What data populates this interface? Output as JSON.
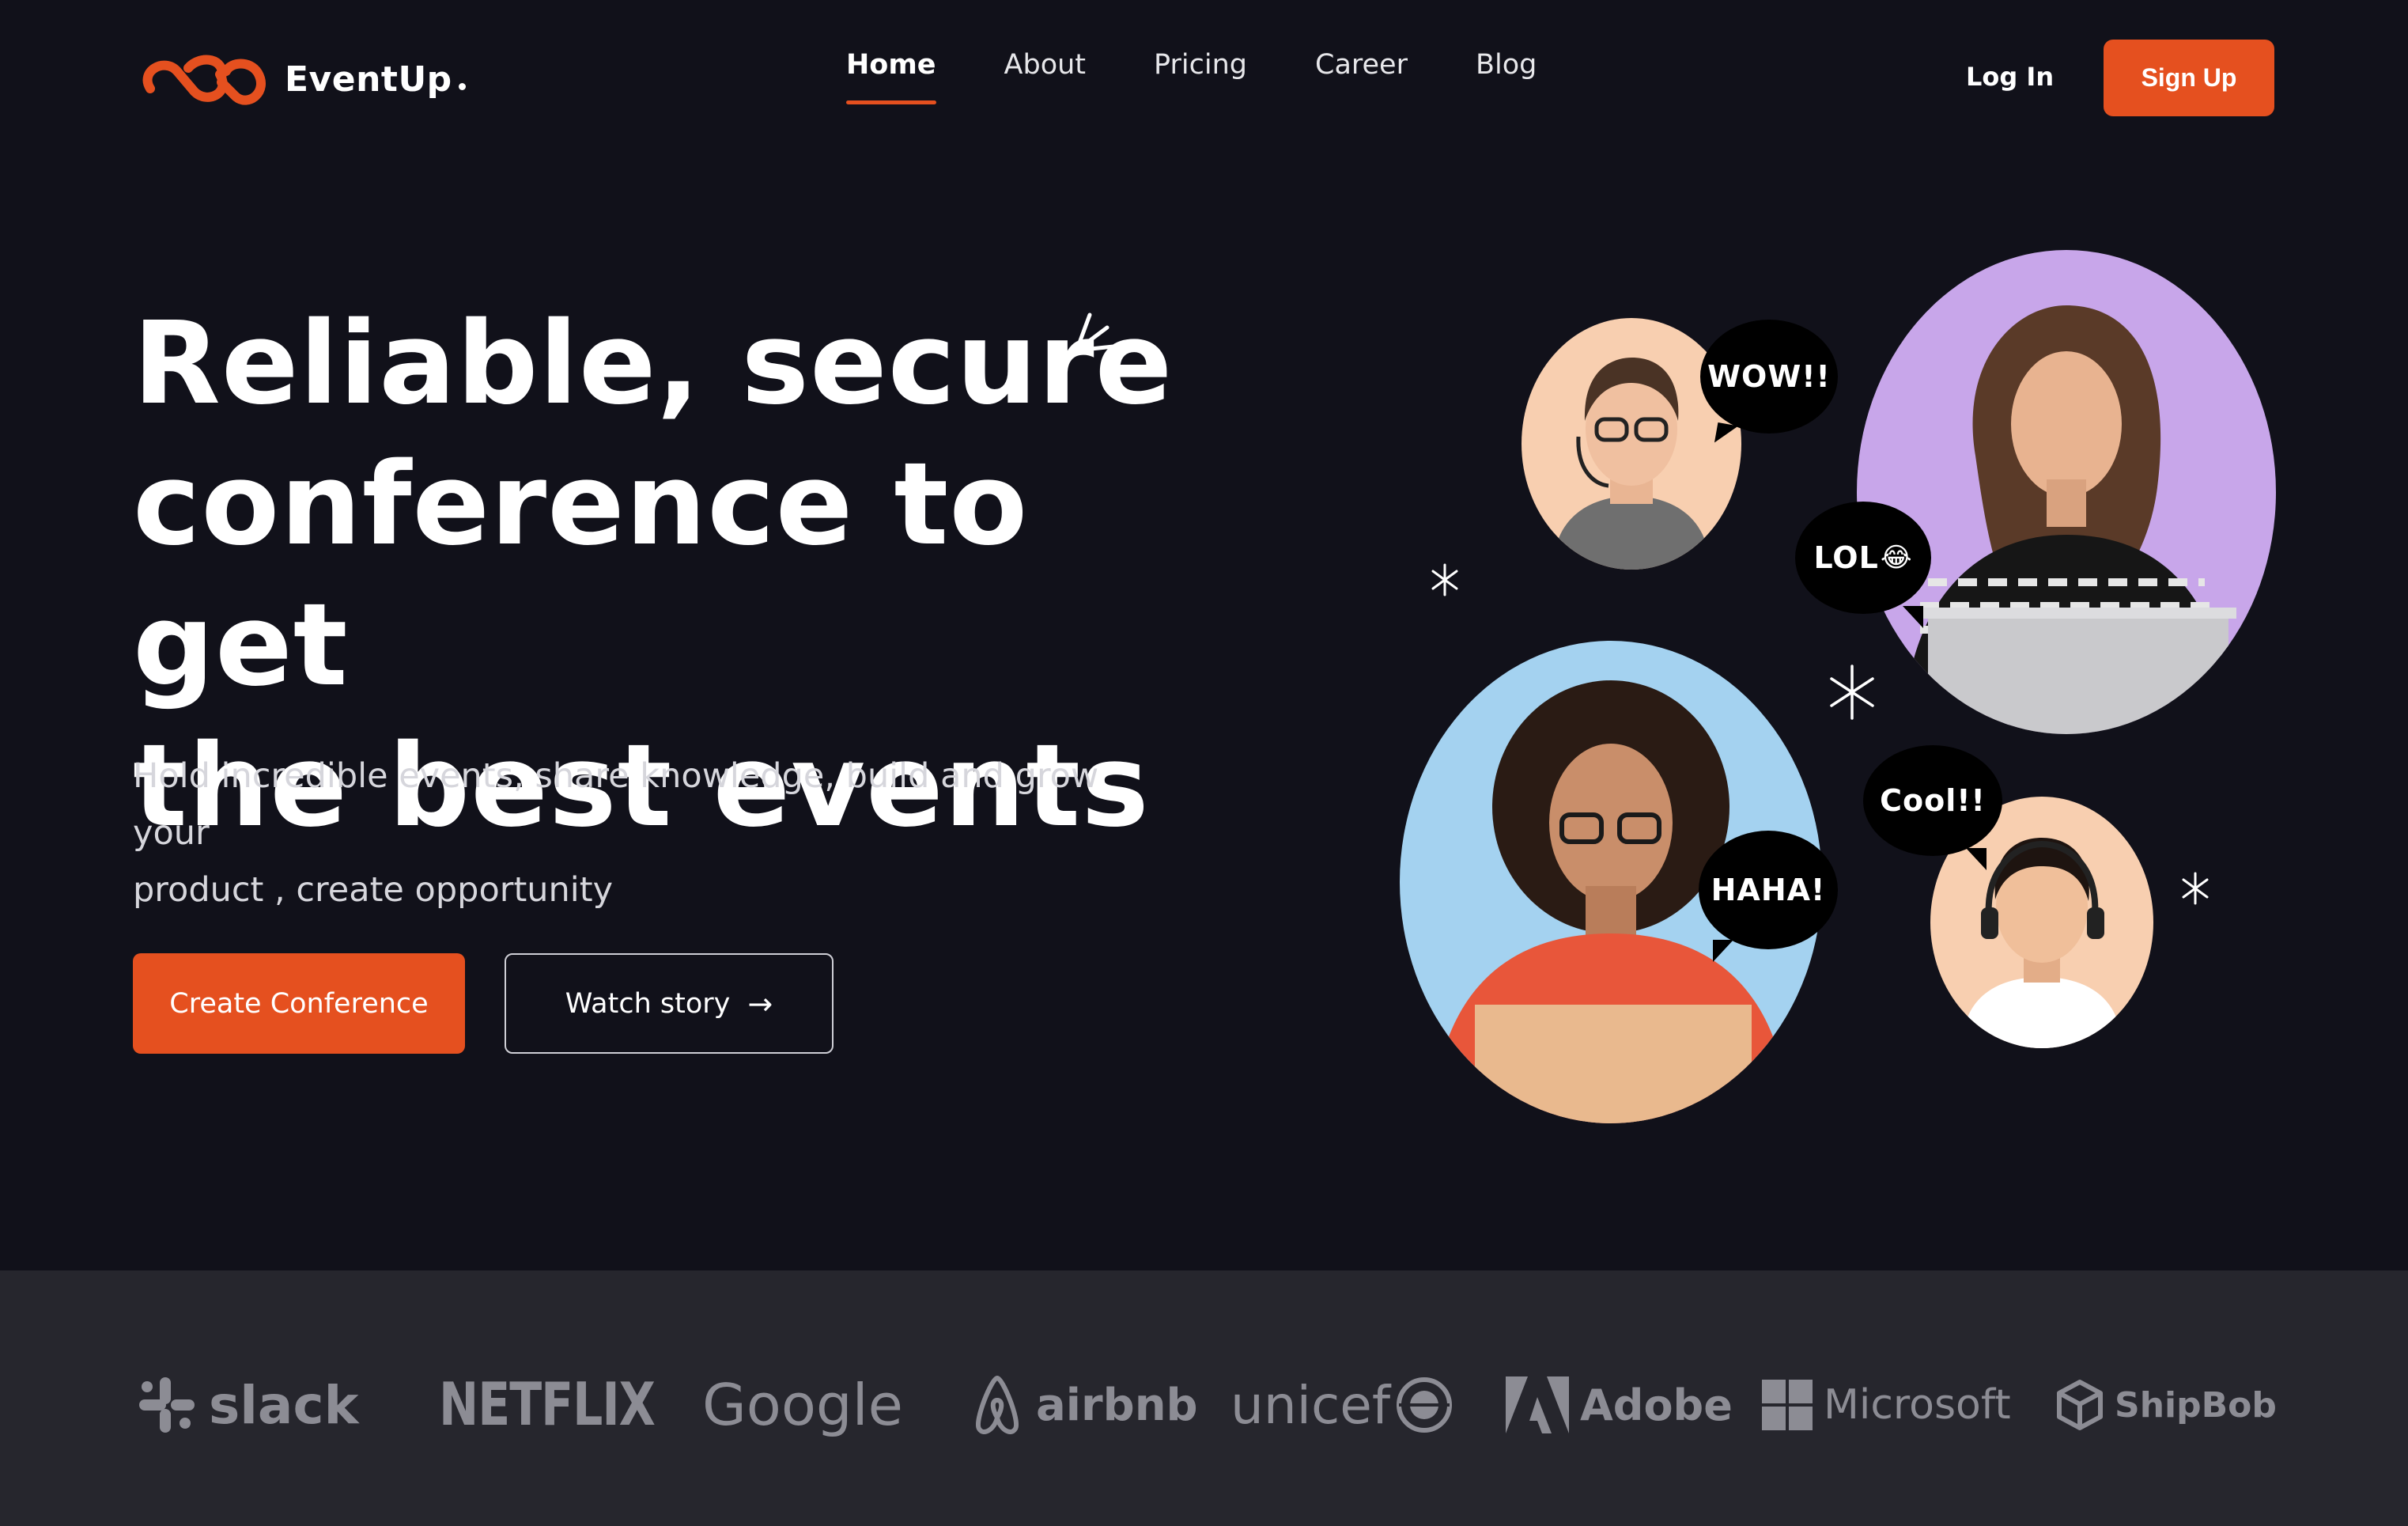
{
  "brand": {
    "name": "EventUp",
    "accent": "#e5501f",
    "background": "#11111a",
    "logo_icon": "infinity-loop-icon"
  },
  "nav": {
    "items": [
      {
        "label": "Home",
        "active": true
      },
      {
        "label": "About",
        "active": false
      },
      {
        "label": "Pricing",
        "active": false
      },
      {
        "label": "Career",
        "active": false
      },
      {
        "label": "Blog",
        "active": false
      }
    ]
  },
  "auth": {
    "login_label": "Log In",
    "signup_label": "Sign Up"
  },
  "hero": {
    "title_lines": [
      "Reliable, secure",
      "conference to get",
      "the best events"
    ],
    "subtitle_lines": [
      "Hold incredible events, share knowledge, build and grow your",
      "product , create opportunity"
    ],
    "primary_button": "Create Conference",
    "secondary_button": "Watch story",
    "secondary_icon": "arrow-right-icon"
  },
  "illustration": {
    "bubbles": {
      "wow": "WOW!!",
      "lol": "LOL",
      "lol_emoji": "😂",
      "haha": "HAHA!",
      "cool": "Cool!!"
    },
    "circle_colors": {
      "peach": "#f8cfb0",
      "lavender": "#c8a6ea",
      "sky": "#a4d2f0"
    }
  },
  "partners": {
    "background": "#26262d",
    "items": [
      {
        "name": "slack",
        "icon": "slack-logo-icon"
      },
      {
        "name": "NETFLIX"
      },
      {
        "name": "Google"
      },
      {
        "name": "airbnb",
        "icon": "airbnb-logo-icon"
      },
      {
        "name": "unicef",
        "icon": "unicef-globe-icon"
      },
      {
        "name": "Adobe",
        "icon": "adobe-logo-icon"
      },
      {
        "name": "Microsoft",
        "icon": "microsoft-logo-icon"
      },
      {
        "name": "ShipBob",
        "icon": "shipbob-logo-icon"
      }
    ]
  }
}
